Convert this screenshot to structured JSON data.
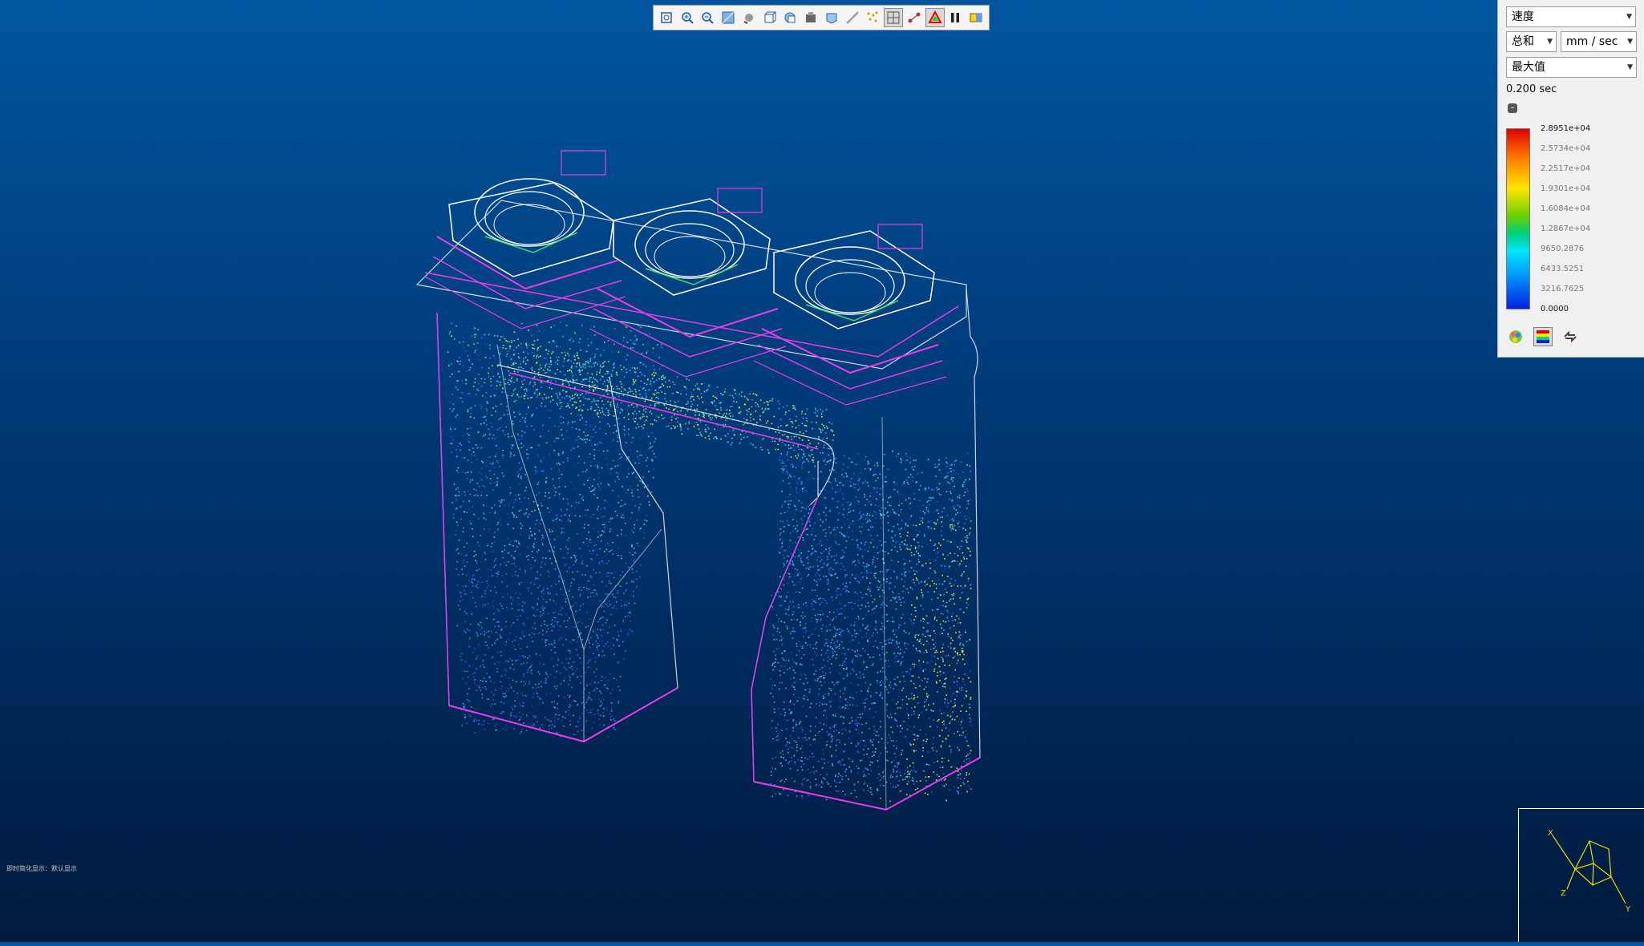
{
  "toolbar": {
    "buttons": [
      {
        "name": "zoom-fit-icon"
      },
      {
        "name": "zoom-in-icon"
      },
      {
        "name": "zoom-out-icon"
      },
      {
        "name": "shade-icon"
      },
      {
        "name": "rotate-icon"
      },
      {
        "name": "wireframe-box-icon"
      },
      {
        "name": "view-orient-icon"
      },
      {
        "name": "screenshot-icon"
      },
      {
        "name": "surface-icon"
      },
      {
        "name": "slice-icon"
      },
      {
        "name": "particles-icon"
      },
      {
        "name": "mesh-icon"
      },
      {
        "name": "tracer-icon"
      },
      {
        "name": "color-triangle-icon"
      },
      {
        "name": "pause-icon"
      },
      {
        "name": "legend-toggle-icon"
      }
    ],
    "active": [
      "mesh-icon",
      "color-triangle-icon"
    ]
  },
  "panel": {
    "quantity": "速度",
    "component": "总和",
    "unit": "mm / sec",
    "mode": "最大值",
    "time": "0.200 sec",
    "scale_ticks": [
      "2.8951e+04",
      "2.5734e+04",
      "2.2517e+04",
      "1.9301e+04",
      "1.6084e+04",
      "1.2867e+04",
      "9650.2876",
      "6433.5251",
      "3216.7625",
      "0.0000"
    ],
    "scale_colors": [
      "#e00000",
      "#ff7a00",
      "#ffe600",
      "#6cd100",
      "#00d07a",
      "#00e5ff",
      "#00a0ff",
      "#0020e0"
    ]
  },
  "status_text": "即时简化显示：默认显示",
  "triad": {
    "labels": [
      "X",
      "Y",
      "Z"
    ]
  }
}
